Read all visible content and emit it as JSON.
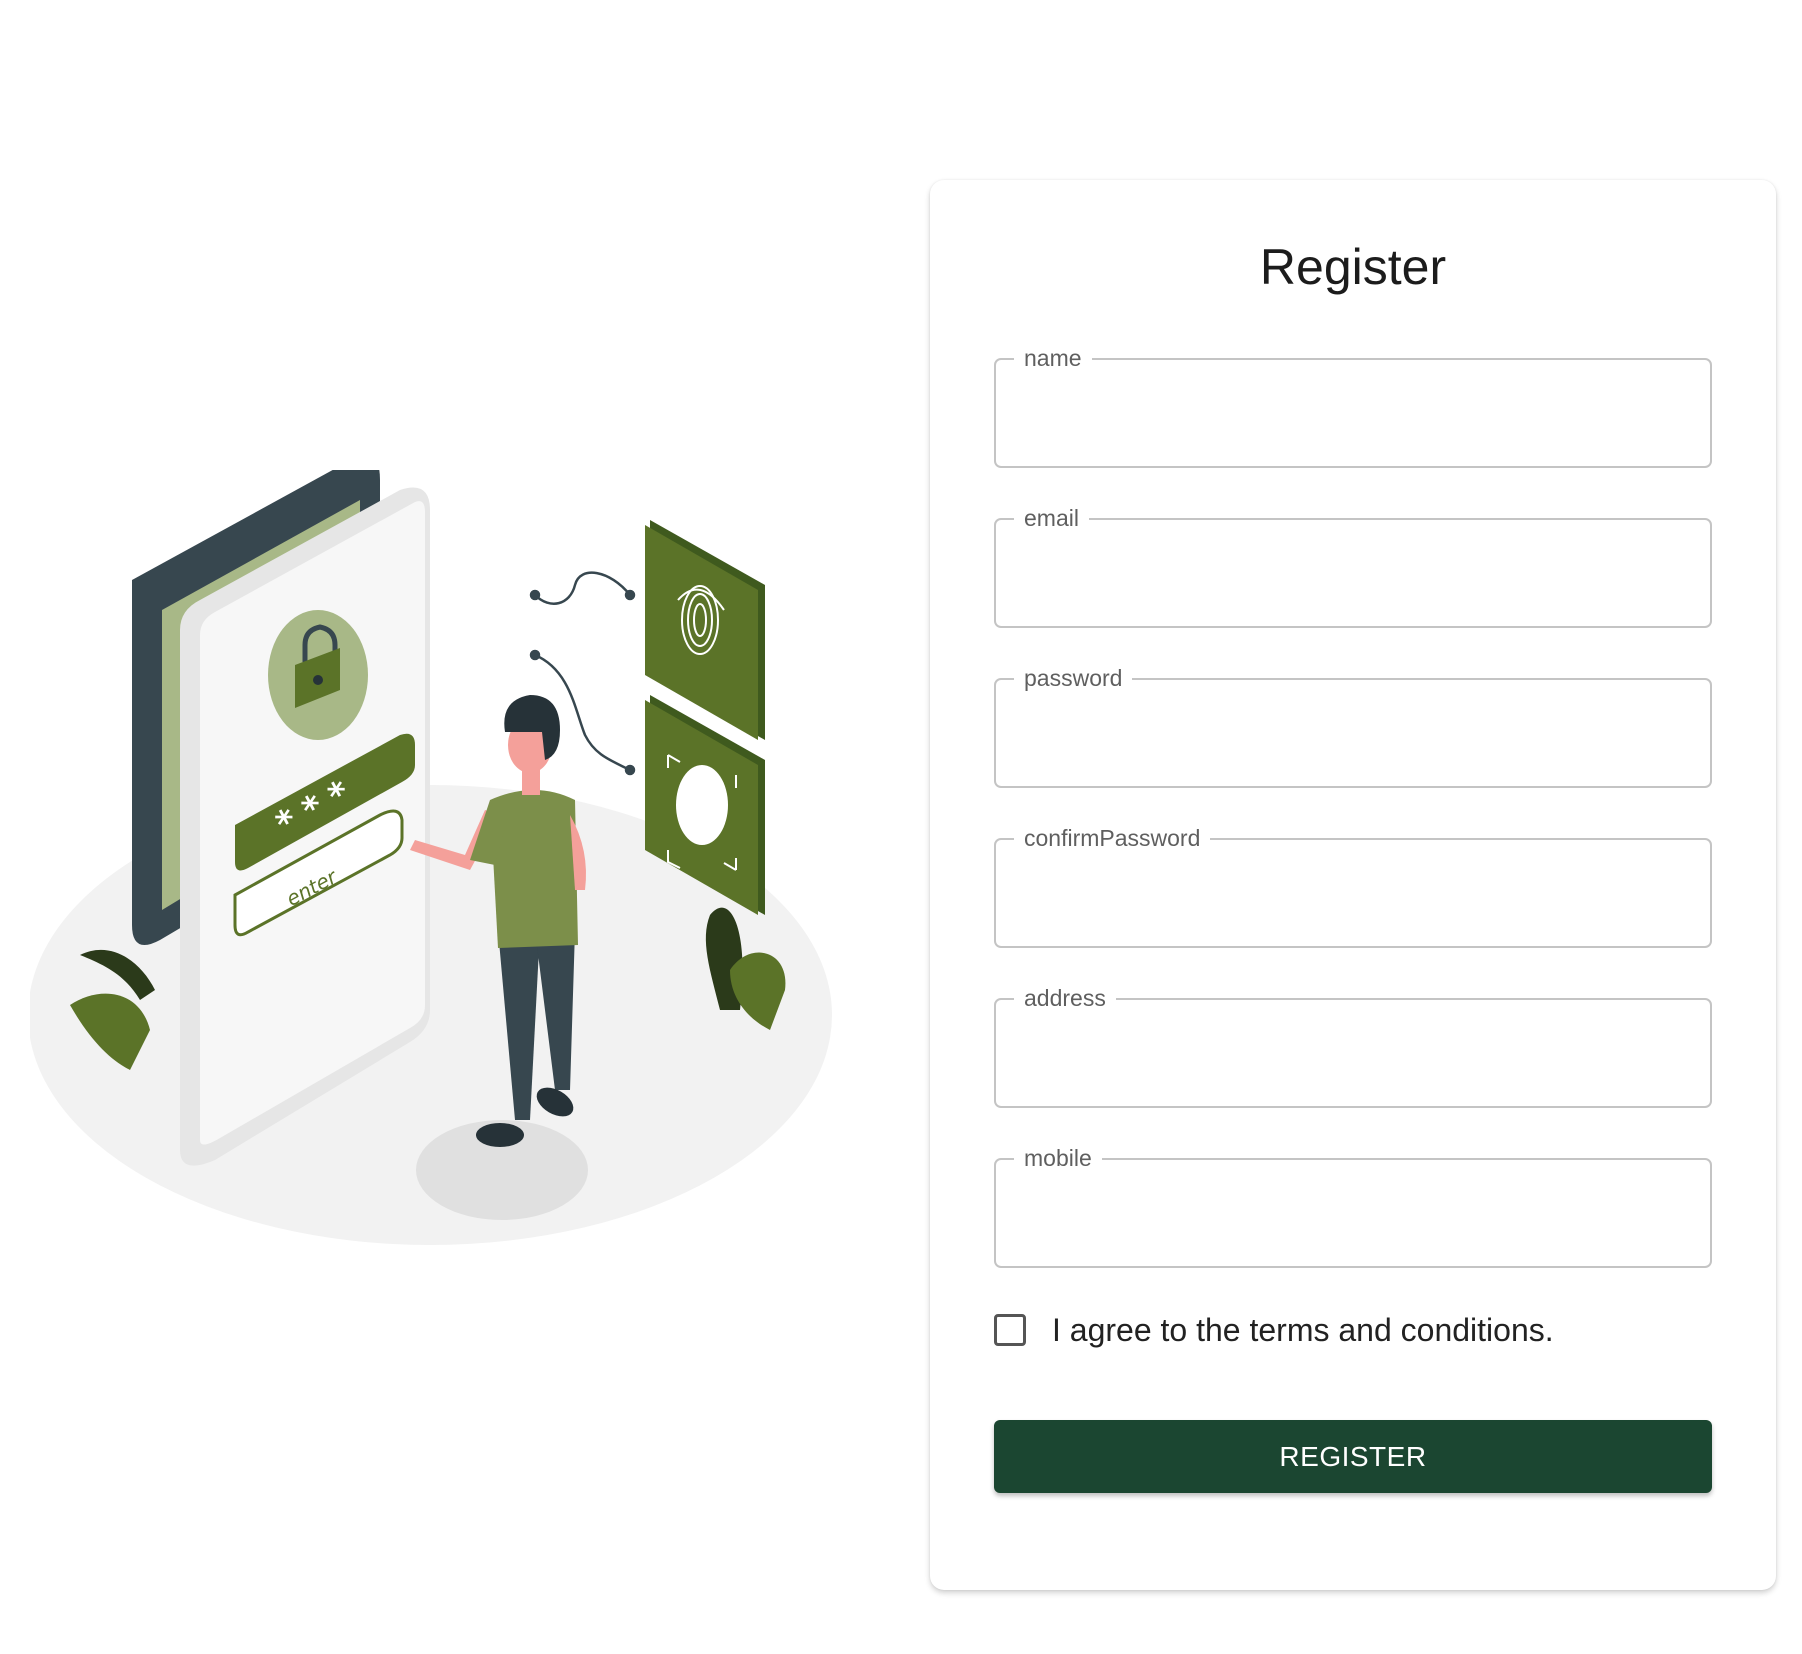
{
  "form": {
    "title": "Register",
    "fields": [
      {
        "label": "name",
        "value": "",
        "type": "text"
      },
      {
        "label": "email",
        "value": "",
        "type": "email"
      },
      {
        "label": "password",
        "value": "",
        "type": "password"
      },
      {
        "label": "confirmPassword",
        "value": "",
        "type": "password"
      },
      {
        "label": "address",
        "value": "",
        "type": "text"
      },
      {
        "label": "mobile",
        "value": "",
        "type": "tel"
      }
    ],
    "terms": {
      "label": "I agree to the terms and conditions.",
      "checked": false
    },
    "submit_label": "REGISTER"
  },
  "illustration": {
    "phone_button_label": "enter",
    "password_mask": "* * *",
    "icons": [
      "lock-icon",
      "fingerprint-icon",
      "face-scan-icon"
    ]
  },
  "colors": {
    "accent": "#1b4631",
    "illustration_green": "#5b7328",
    "illustration_light_green": "#a8b887",
    "phone_dark": "#37474f",
    "platform": "#f2f2f2"
  }
}
